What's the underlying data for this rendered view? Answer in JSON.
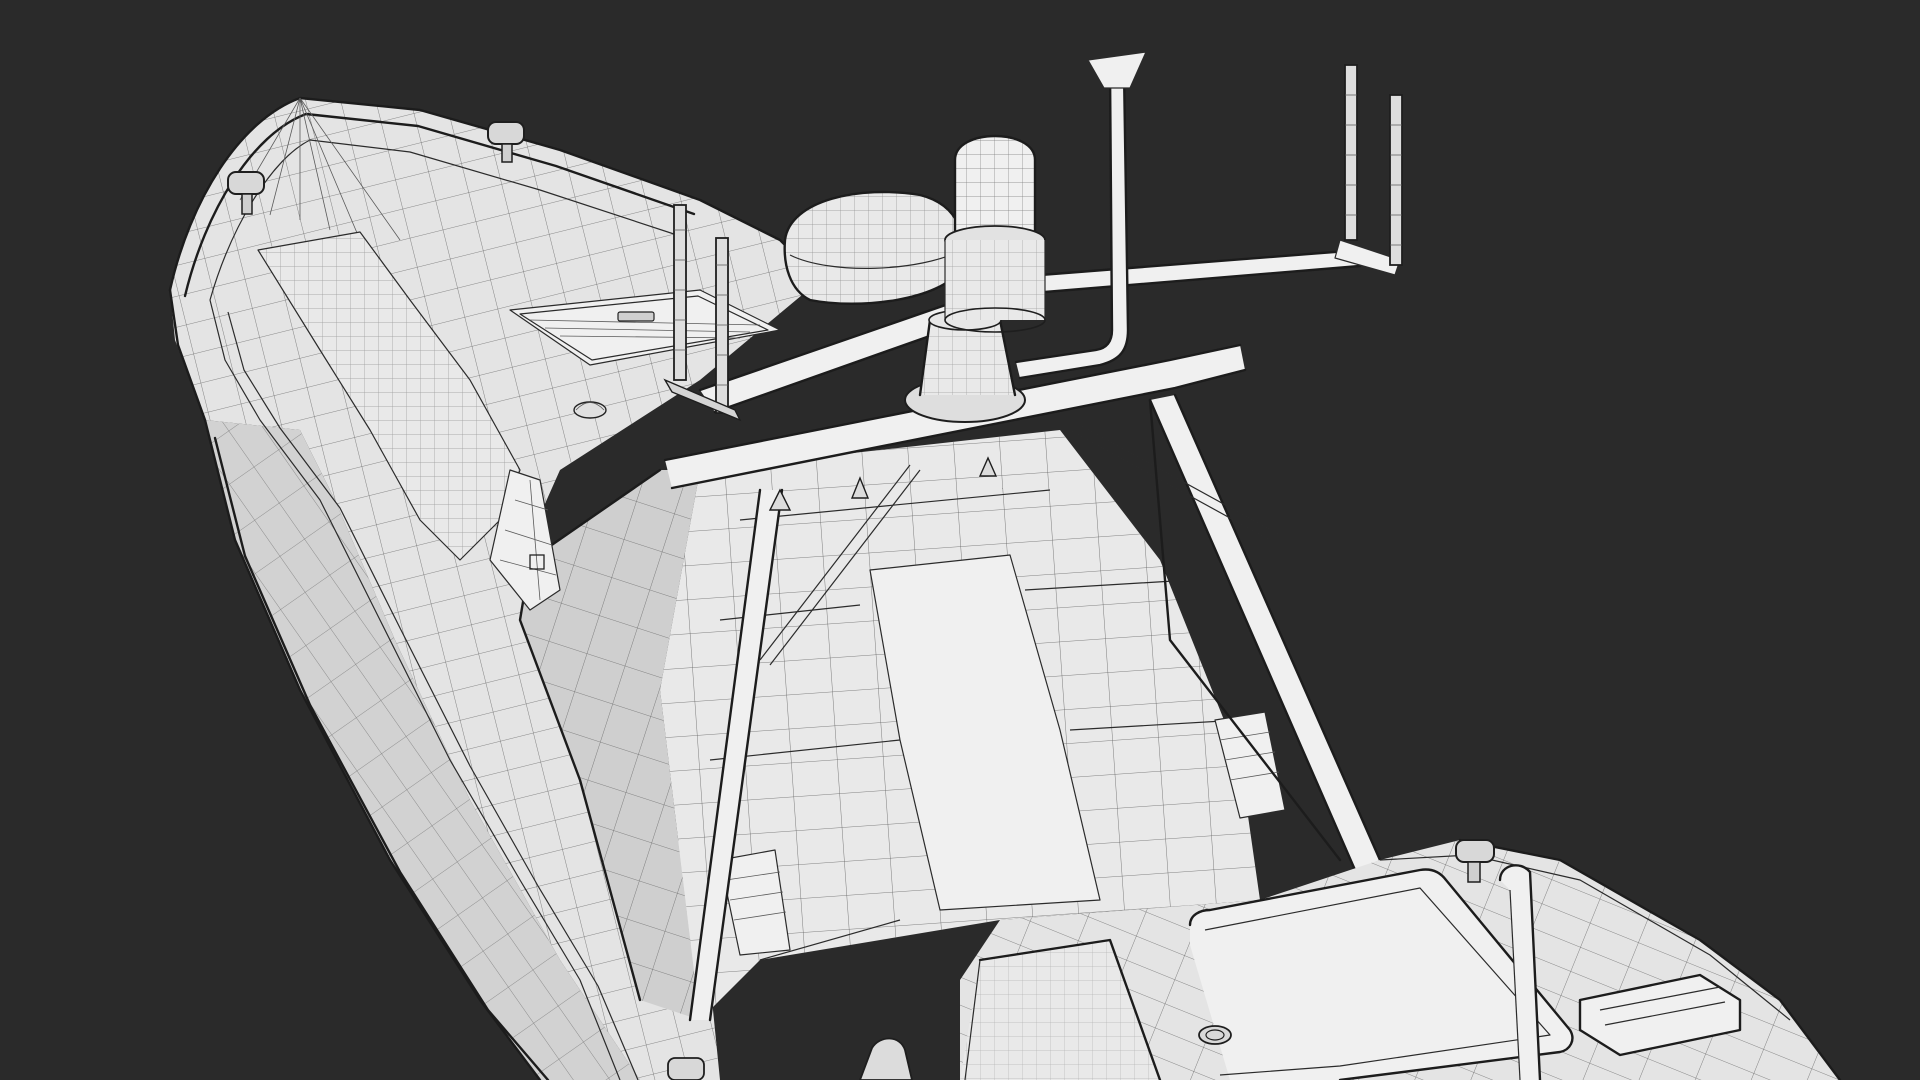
{
  "scene": {
    "background_color": "#2a2a2a",
    "subject": "wireframe-boat-render",
    "mesh_line_color": "#3a3a3a",
    "surface_color": "#e6e6e6"
  }
}
